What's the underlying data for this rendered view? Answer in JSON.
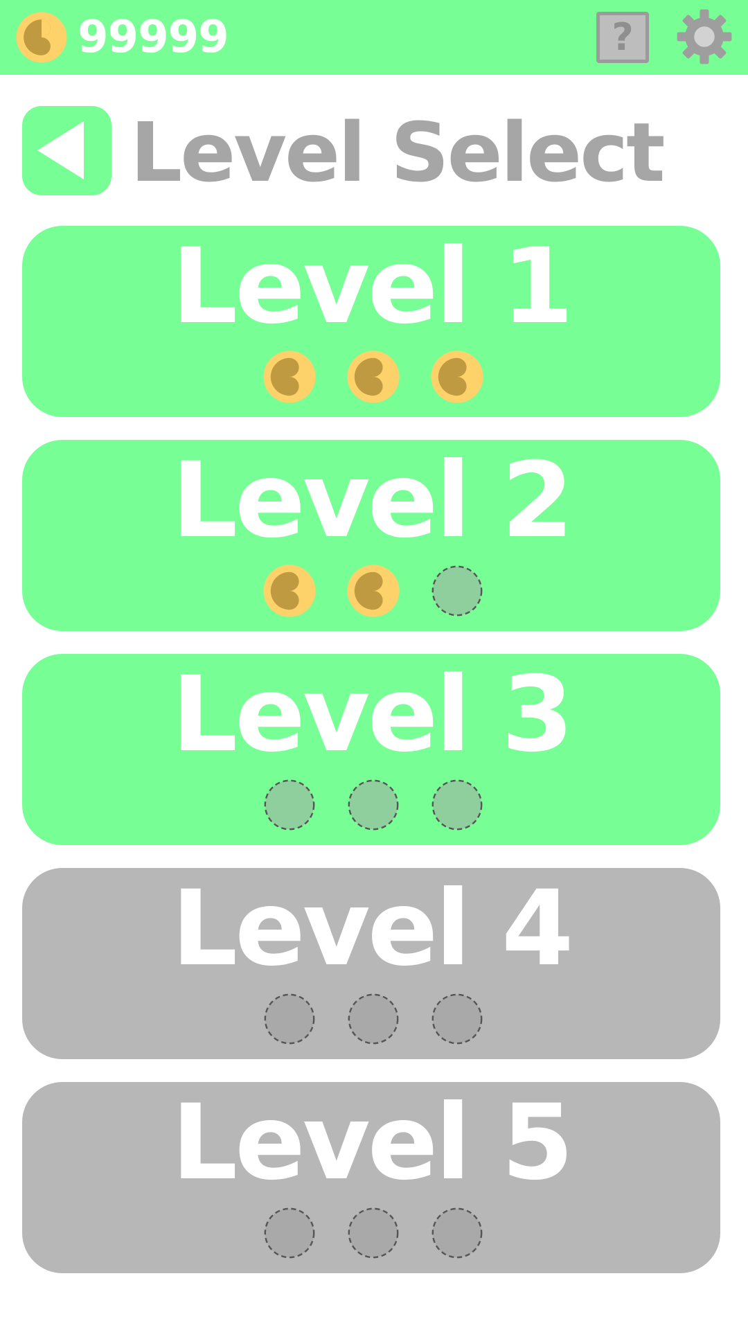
{
  "header": {
    "coin_count": "99999",
    "coin_icon": "coin-icon",
    "help_icon": "help-icon",
    "help_label": "?",
    "settings_icon": "gear-icon"
  },
  "title_bar": {
    "back_icon": "back-arrow-icon",
    "title": "Level Select"
  },
  "levels": [
    {
      "label": "Level 1",
      "state": "unlocked",
      "stars_earned": 3,
      "stars_total": 3
    },
    {
      "label": "Level 2",
      "state": "unlocked",
      "stars_earned": 2,
      "stars_total": 3
    },
    {
      "label": "Level 3",
      "state": "unlocked",
      "stars_earned": 0,
      "stars_total": 3
    },
    {
      "label": "Level 4",
      "state": "locked",
      "stars_earned": 0,
      "stars_total": 3
    },
    {
      "label": "Level 5",
      "state": "locked",
      "stars_earned": 0,
      "stars_total": 3
    }
  ],
  "colors": {
    "accent_green": "#77ff95",
    "locked_gray": "#b7b7b7",
    "title_gray": "#a6a6a6",
    "coin_light": "#fdd26a",
    "coin_dark": "#c09a40",
    "empty_slot_unlocked": "#8fcf9d",
    "empty_slot_locked": "#a9a9a9"
  }
}
